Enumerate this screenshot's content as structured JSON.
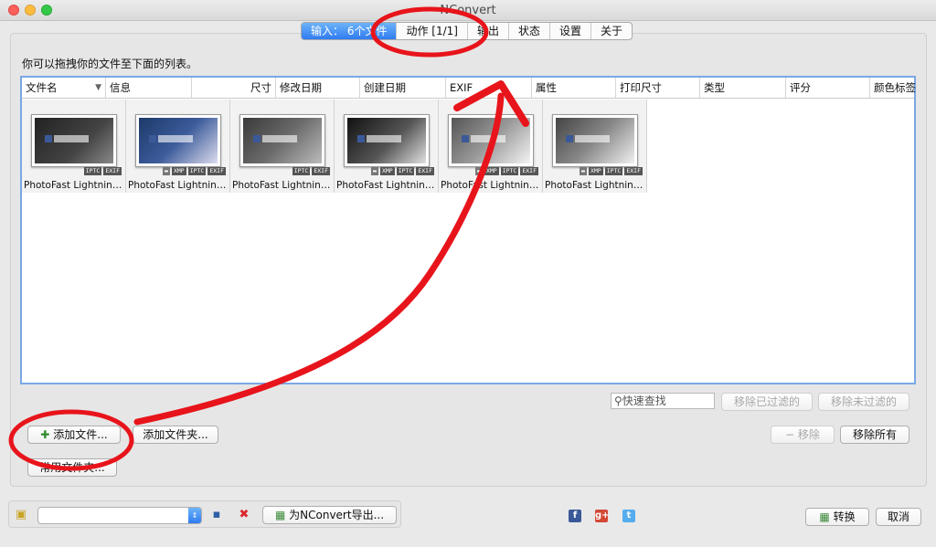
{
  "window": {
    "title": "NConvert"
  },
  "tabs": [
    {
      "label": "输入： 6个文件",
      "active": true
    },
    {
      "label": "动作 [1/1]"
    },
    {
      "label": "输出"
    },
    {
      "label": "状态"
    },
    {
      "label": "设置"
    },
    {
      "label": "关于"
    }
  ],
  "hint": "你可以拖拽你的文件至下面的列表。",
  "columns": [
    "文件名",
    "信息",
    "尺寸",
    "修改日期",
    "创建日期",
    "EXIF",
    "属性",
    "打印尺寸",
    "类型",
    "评分",
    "颜色标签"
  ],
  "files": [
    {
      "name": "PhotoFast Lightning_0...",
      "badges": [
        "IPTC",
        "EXIF"
      ]
    },
    {
      "name": "PhotoFast Lightning_0...",
      "badges": [
        "XMP",
        "IPTC",
        "EXIF"
      ]
    },
    {
      "name": "PhotoFast Lightning_0...",
      "badges": [
        "IPTC",
        "EXIF"
      ]
    },
    {
      "name": "PhotoFast Lightning_0...",
      "badges": [
        "XMP",
        "IPTC",
        "EXIF"
      ]
    },
    {
      "name": "PhotoFast Lightning_0...",
      "badges": [
        "XMP",
        "IPTC",
        "EXIF"
      ]
    },
    {
      "name": "PhotoFast Lightning_0...",
      "badges": [
        "XMP",
        "IPTC",
        "EXIF"
      ]
    }
  ],
  "search": {
    "placeholder": "快速查找"
  },
  "buttons": {
    "remove_filtered": "移除已过滤的",
    "remove_unfiltered": "移除未过滤的",
    "add_files": "添加文件...",
    "add_folder": "添加文件夹...",
    "common_folders": "常用文件夹...",
    "remove": "移除",
    "remove_all": "移除所有",
    "export_nconvert": "为NConvert导出...",
    "convert": "转换",
    "cancel": "取消"
  },
  "icons": {
    "folder": "folder-icon",
    "save": "save-icon",
    "delete": "delete-icon",
    "facebook": "facebook-icon",
    "google_plus": "google-plus-icon",
    "twitter": "twitter-icon"
  },
  "colors": {
    "accent": "#2f7bf0",
    "annotation": "#e8141b"
  }
}
